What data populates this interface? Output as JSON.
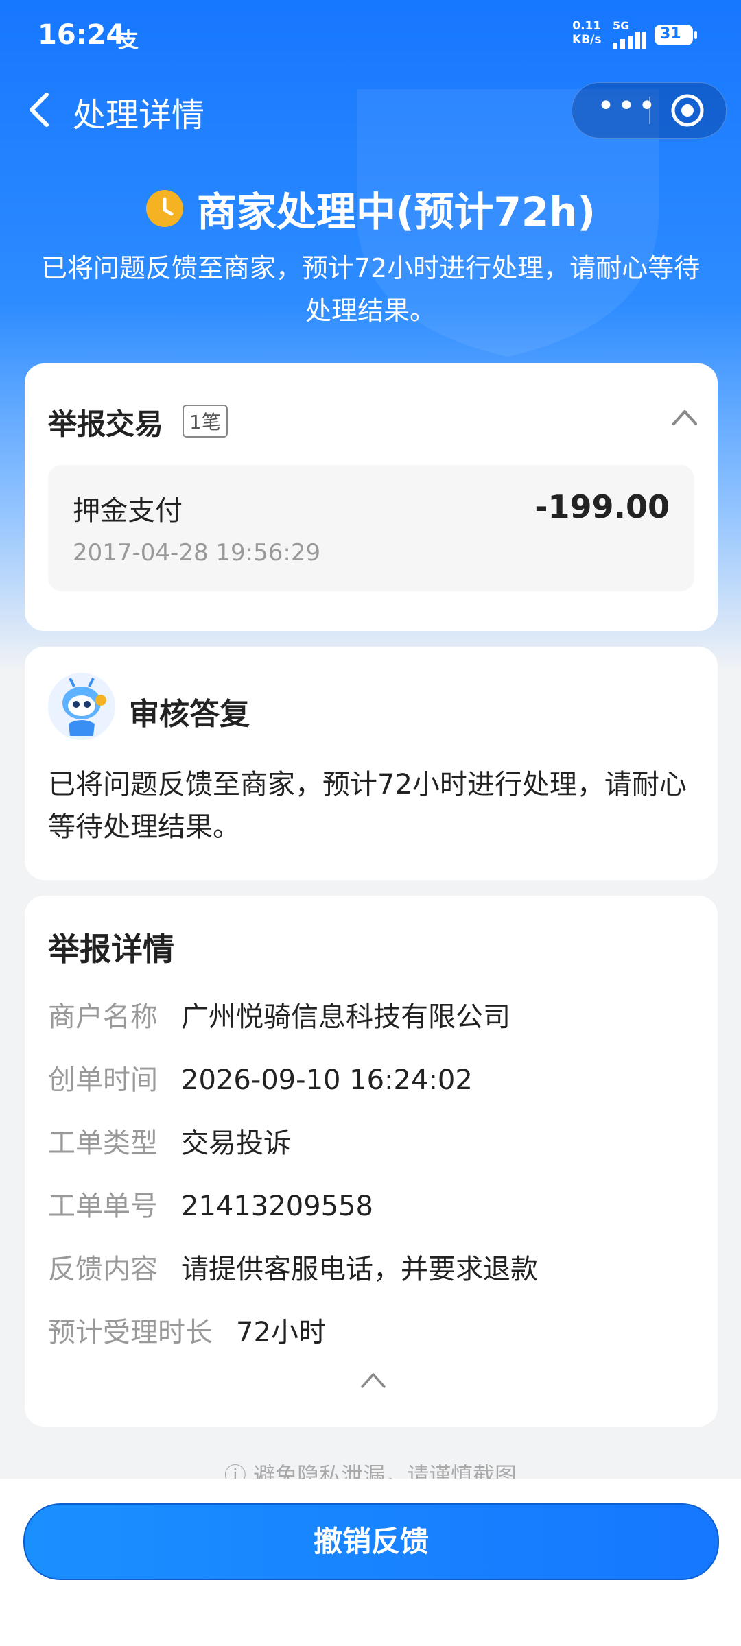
{
  "status_bar": {
    "time": "16:24",
    "app_glyph": "支",
    "net_speed_value": "0.11",
    "net_speed_unit": "KB/s",
    "network": "5G",
    "battery": "31"
  },
  "nav": {
    "title": "处理详情",
    "more_label": "•••"
  },
  "state": {
    "title": "商家处理中(预计72h)",
    "description": "已将问题反馈至商家，预计72小时进行处理，请耐心等待处理结果。",
    "icon_color": "#f5b324"
  },
  "report_transactions": {
    "title": "举报交易",
    "count_badge": "1笔",
    "item": {
      "name": "押金支付",
      "amount": "-199.00",
      "timestamp": "2017-04-28 19:56:29"
    }
  },
  "review_reply": {
    "title": "审核答复",
    "body": "已将问题反馈至商家，预计72小时进行处理，请耐心等待处理结果。"
  },
  "report_details": {
    "title": "举报详情",
    "rows": [
      {
        "label": "商户名称",
        "value": "广州悦骑信息科技有限公司"
      },
      {
        "label": "创单时间",
        "value": "2026-09-10 16:24:02"
      },
      {
        "label": "工单类型",
        "value": "交易投诉"
      },
      {
        "label": "工单单号",
        "value": "21413209558"
      },
      {
        "label": "反馈内容",
        "value": "请提供客服电话，并要求退款"
      },
      {
        "label": "预计受理时长",
        "value": "72小时"
      }
    ]
  },
  "privacy_notice": "ⓘ 避免隐私泄漏，请谨慎截图",
  "bottom": {
    "cancel_label": "撤销反馈"
  },
  "colors": {
    "brand_blue": "#1677ff",
    "background": "#f2f3f5"
  }
}
